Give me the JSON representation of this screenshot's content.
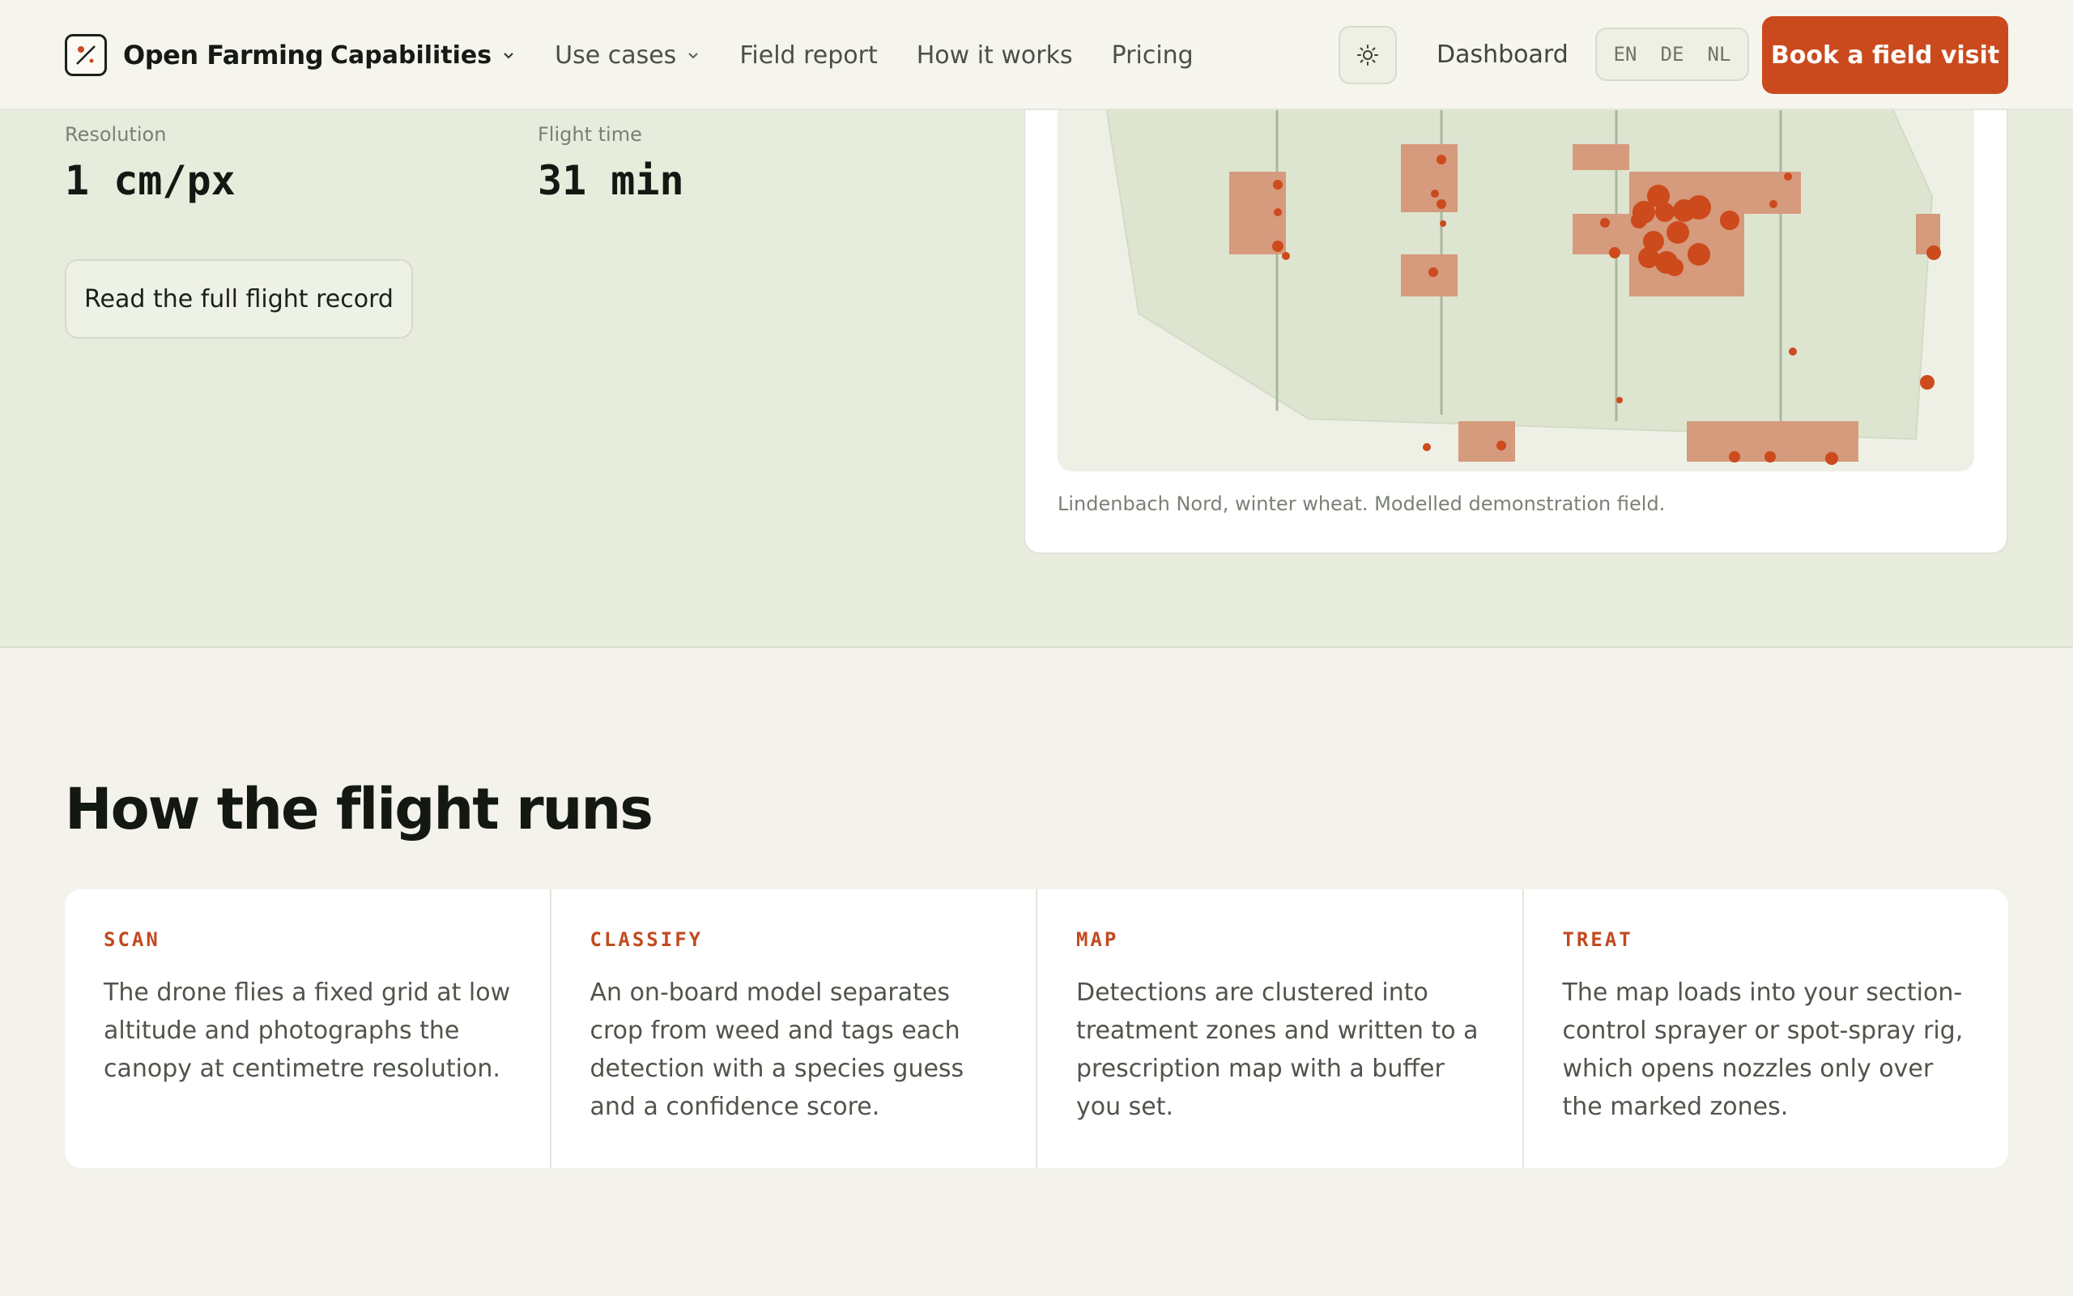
{
  "nav": {
    "brand": "Open Farming",
    "links": [
      {
        "label": "Capabilities",
        "dropdown": true,
        "active": true
      },
      {
        "label": "Use cases",
        "dropdown": true,
        "active": false
      },
      {
        "label": "Field report",
        "dropdown": false,
        "active": false
      },
      {
        "label": "How it works",
        "dropdown": false,
        "active": false
      },
      {
        "label": "Pricing",
        "dropdown": false,
        "active": false
      }
    ],
    "theme_toggle_icon": "sun-icon",
    "dashboard": "Dashboard",
    "languages": [
      "EN",
      "DE",
      "NL"
    ],
    "cta": "Book a field visit"
  },
  "hero": {
    "stats": [
      {
        "label": "Resolution",
        "value": "1 cm/px"
      },
      {
        "label": "Flight time",
        "value": "31 min"
      }
    ],
    "secondary_button": "Read the full flight record",
    "map_caption": "Lindenbach Nord, winter wheat. Modelled demonstration field."
  },
  "section": {
    "title": "How the flight runs",
    "steps": [
      {
        "label": "SCAN",
        "text": "The drone flies a fixed grid at low altitude and photographs the canopy at centimetre resolution."
      },
      {
        "label": "CLASSIFY",
        "text": "An on-board model separates crop from weed and tags each detection with a species guess and a confidence score."
      },
      {
        "label": "MAP",
        "text": "Detections are clustered into treatment zones and written to a prescription map with a buffer you set."
      },
      {
        "label": "TREAT",
        "text": "The map loads into your section-control sprayer or spot-spray rig, which opens nozzles only over the marked zones."
      }
    ]
  },
  "colors": {
    "accent": "#cb4a1d",
    "hero_bg": "#e8ecdd",
    "page_bg": "#f3f3ec",
    "field": "#dde5d0",
    "zone": "#d69a7c",
    "detection": "#cc4a1c"
  }
}
